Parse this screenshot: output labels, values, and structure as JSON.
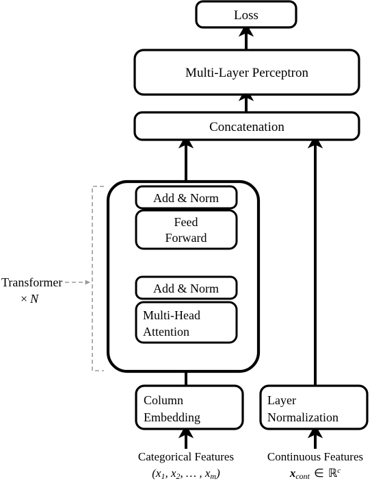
{
  "figure": {
    "type": "architecture-diagram",
    "title": "TabTransformer architecture",
    "background_color": "#ffffff",
    "line_color": "#000000",
    "bracket_color": "#9a9a9a"
  },
  "nodes": {
    "loss": "Loss",
    "mlp": "Multi-Layer Perceptron",
    "concatenation": "Concatenation",
    "add_norm_top": "Add & Norm",
    "feed_forward_line1": "Feed",
    "feed_forward_line2": "Forward",
    "add_norm_bottom": "Add & Norm",
    "attention_line1": "Multi-Head",
    "attention_line2": "Attention",
    "column_embedding_line1": "Column",
    "column_embedding_line2": "Embedding",
    "layer_norm_line1": "Layer",
    "layer_norm_line2": "Normalization"
  },
  "annotations": {
    "transformer_label": "Transformer",
    "transformer_repeat_symbol": "×",
    "transformer_repeat_count": "N"
  },
  "inputs": {
    "categorical": {
      "caption": "Categorical Features",
      "math_open": "(",
      "math_x1": "x",
      "math_x1_sub": "1",
      "math_sep1": ", ",
      "math_x2": "x",
      "math_x2_sub": "2",
      "math_sep2": ", … , ",
      "math_xm": "x",
      "math_xm_sub": "m",
      "math_close": ")"
    },
    "continuous": {
      "caption": "Continuous Features",
      "math_x": "x",
      "math_x_sub": "cont",
      "math_in": "∈",
      "math_set": "ℝ",
      "math_set_sup": "c"
    }
  }
}
